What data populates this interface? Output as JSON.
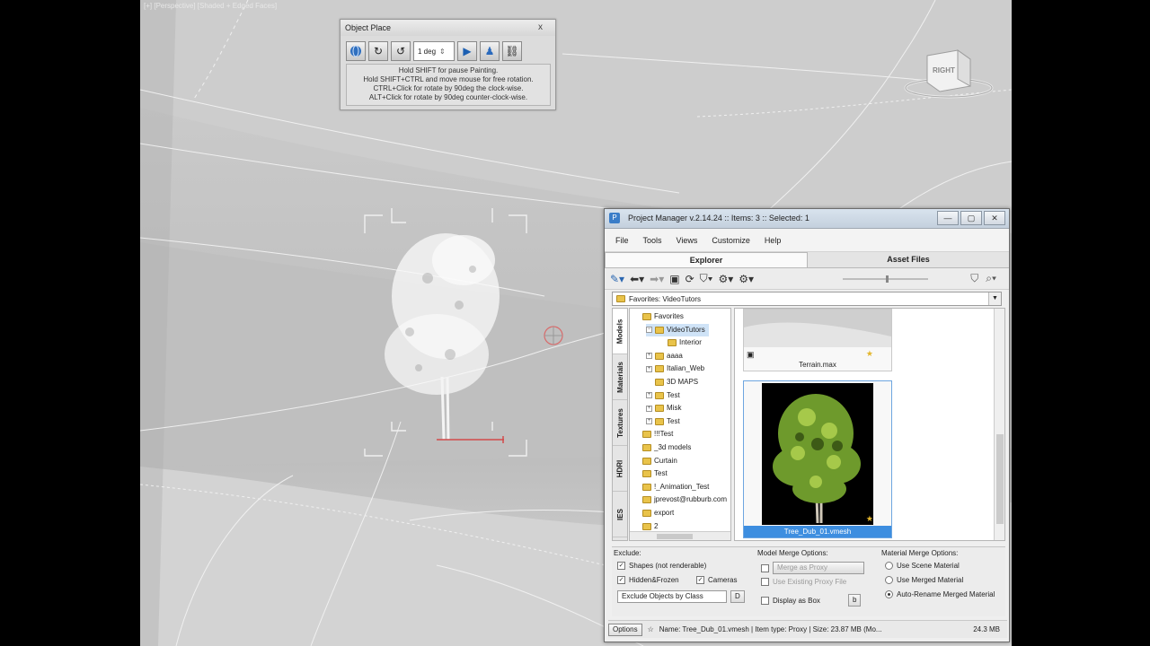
{
  "viewport": {
    "label": "[+] [Perspective] [Shaded + Edged Faces]",
    "viewcube_face": "RIGHT"
  },
  "object_place": {
    "title": "Object Place",
    "close": "x",
    "deg_value": "1 deg",
    "icons": [
      "globe-icon",
      "rotate-cw-icon",
      "rotate-ccw-icon",
      "play-icon",
      "person-icon",
      "link-icon"
    ],
    "help_lines": [
      "Hold SHIFT for pause Painting.",
      "Hold SHIFT+CTRL and move mouse for free rotation.",
      "CTRL+Click for rotate by 90deg the clock-wise.",
      "ALT+Click for rotate by 90deg counter-clock-wise."
    ]
  },
  "project_manager": {
    "title": "Project Manager v.2.14.24   :: Items: 3   :: Selected: 1",
    "window_buttons": [
      "—",
      "▢",
      "✕"
    ],
    "menu": [
      "File",
      "Tools",
      "Views",
      "Customize",
      "Help"
    ],
    "tabs": [
      "Explorer",
      "Asset Files"
    ],
    "path": "Favorites: VideoTutors",
    "side_tabs": [
      "Models",
      "Materials",
      "Textures",
      "HDRI",
      "IES"
    ],
    "tree": [
      {
        "label": "Favorites",
        "indent": 0,
        "exp": ""
      },
      {
        "label": "VideoTutors",
        "indent": 1,
        "exp": "−",
        "selected": true
      },
      {
        "label": "Interior",
        "indent": 2,
        "exp": ""
      },
      {
        "label": "aaaa",
        "indent": 1,
        "exp": "+"
      },
      {
        "label": "Italian_Web",
        "indent": 1,
        "exp": "+"
      },
      {
        "label": "3D MAPS",
        "indent": 1,
        "exp": ""
      },
      {
        "label": "Test",
        "indent": 1,
        "exp": "+"
      },
      {
        "label": "Misk",
        "indent": 1,
        "exp": "+"
      },
      {
        "label": "Test",
        "indent": 1,
        "exp": "+"
      },
      {
        "label": "!!!Test",
        "indent": 0,
        "exp": ""
      },
      {
        "label": "_3d models",
        "indent": 0,
        "exp": ""
      },
      {
        "label": "Curtain",
        "indent": 0,
        "exp": ""
      },
      {
        "label": "Test",
        "indent": 0,
        "exp": ""
      },
      {
        "label": "!_Animation_Test",
        "indent": 0,
        "exp": ""
      },
      {
        "label": "jprevost@rubburb.com",
        "indent": 0,
        "exp": ""
      },
      {
        "label": "export",
        "indent": 0,
        "exp": ""
      },
      {
        "label": "2",
        "indent": 0,
        "exp": ""
      }
    ],
    "thumbs": [
      {
        "caption": "Terrain.max"
      },
      {
        "caption": "Tree_Dub_01.vmesh",
        "selected": true
      }
    ],
    "exclude": {
      "header": "Exclude:",
      "shapes": "Shapes (not renderable)",
      "hidden": "Hidden&Frozen",
      "cameras": "Cameras",
      "by_class": "Exclude Objects by Class",
      "d_btn": "D"
    },
    "model_merge": {
      "header": "Model Merge Options:",
      "merge_proxy": "Merge as Proxy",
      "use_existing": "Use Existing Proxy File",
      "display_box": "Display as Box",
      "b_btn": "b"
    },
    "material_merge": {
      "header": "Material Merge Options:",
      "opt1": "Use Scene Material",
      "opt2": "Use Merged Material",
      "opt3": "Auto-Rename Merged Material"
    },
    "status": {
      "options": "Options",
      "info": "Name: Tree_Dub_01.vmesh  |  Item type: Proxy  |  Size: 23.87 MB  (Mo...",
      "mem": "24.3 MB"
    }
  }
}
